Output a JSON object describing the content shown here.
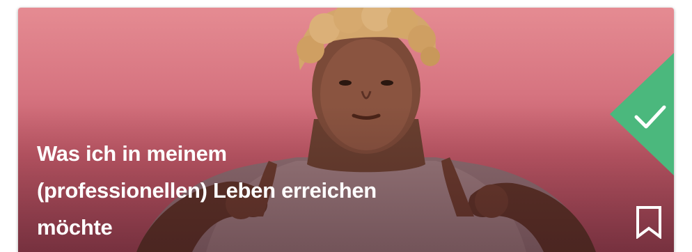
{
  "card": {
    "title_lines": [
      "Was ich in meinem",
      "(professionellen) Leben erreichen",
      "möchte"
    ],
    "completed_icon": "checkmark-icon",
    "bookmark_icon": "bookmark-icon",
    "badge_color": "#4bb87d",
    "background_color": "#d67480"
  }
}
